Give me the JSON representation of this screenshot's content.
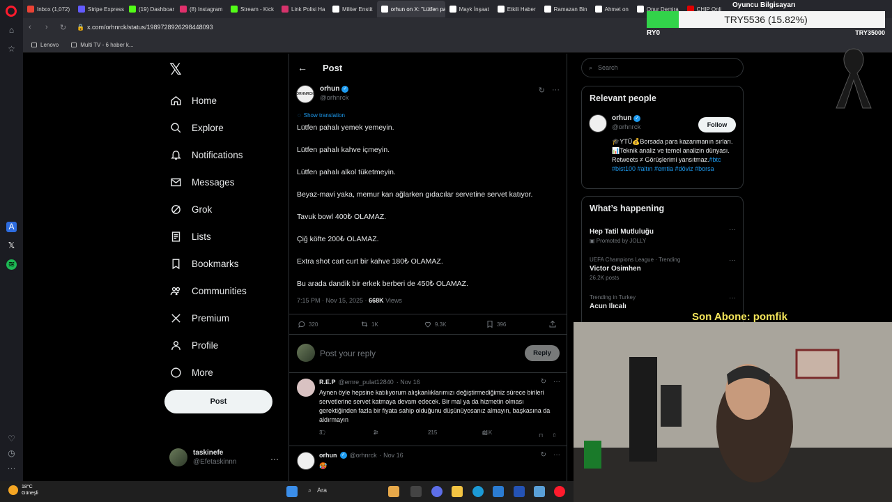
{
  "browser": {
    "tabs": [
      {
        "label": "Inbox (1,072)",
        "color": "#ea4335"
      },
      {
        "label": "Stripe Express",
        "color": "#635bff"
      },
      {
        "label": "(19) Dashboar",
        "color": "#53fc18"
      },
      {
        "label": "(8) Instagram",
        "color": "#e1306c"
      },
      {
        "label": "Stream - Kick",
        "color": "#53fc18"
      },
      {
        "label": "Link Polisi Ha",
        "color": "#d6336c"
      },
      {
        "label": "Militer Enstit",
        "color": "#ffffff"
      },
      {
        "label": "orhun on X: \"Lütfen pah",
        "color": "#ffffff",
        "active": true
      },
      {
        "label": "Mayk İnşaat",
        "color": "#ffffff"
      },
      {
        "label": "Etkili Haber",
        "color": "#ffffff"
      },
      {
        "label": "Ramazan Bin",
        "color": "#ffffff"
      },
      {
        "label": "Ahmet on",
        "color": "#ffffff"
      },
      {
        "label": "Onur Demira",
        "color": "#ffffff"
      },
      {
        "label": "CHIP Onli",
        "color": "#e00000"
      }
    ],
    "url": "x.com/orhnrck/status/1989728926298448093",
    "bookmarks": [
      "Lenovo",
      "Multi TV - 6 haber k..."
    ]
  },
  "nav": {
    "items": [
      {
        "label": "Home",
        "icon": "home-icon"
      },
      {
        "label": "Explore",
        "icon": "search-icon"
      },
      {
        "label": "Notifications",
        "icon": "bell-icon"
      },
      {
        "label": "Messages",
        "icon": "mail-icon"
      },
      {
        "label": "Grok",
        "icon": "grok-icon"
      },
      {
        "label": "Lists",
        "icon": "list-icon"
      },
      {
        "label": "Bookmarks",
        "icon": "bookmark-icon"
      },
      {
        "label": "Communities",
        "icon": "people-icon"
      },
      {
        "label": "Premium",
        "icon": "x-icon"
      },
      {
        "label": "Profile",
        "icon": "person-icon"
      },
      {
        "label": "More",
        "icon": "more-circle-icon"
      }
    ],
    "post_button": "Post",
    "account": {
      "name": "taskinefe",
      "handle": "@Efetaskinnn",
      "more": "···"
    }
  },
  "post": {
    "header": "Post",
    "author": {
      "name": "orhun",
      "handle": "@orhnrck",
      "avatar_text": "ORHNRCK"
    },
    "show_translation": "Show translation",
    "lines": [
      "Lütfen pahalı yemek yemeyin.",
      "Lütfen pahalı kahve içmeyin.",
      "Lütfen pahalı alkol tüketmeyin.",
      "Beyaz-mavi yaka, memur kan ağlarken gıdacılar servetine servet katıyor.",
      "Tavuk bowl 400₺ OLAMAZ.",
      "Çiğ köfte 200₺ OLAMAZ.",
      "Extra shot cart curt bir kahve 180₺ OLAMAZ.",
      "Bu arada dandik bir erkek berberi de 450₺ OLAMAZ."
    ],
    "time": "7:15 PM · Nov 15, 2025 · ",
    "views_count": "668K",
    "views_label": " Views",
    "stats": {
      "replies": "320",
      "reposts": "1K",
      "likes": "9.3K",
      "bookmarks": "396"
    },
    "reply_placeholder": "Post your reply",
    "reply_button": "Reply"
  },
  "replies": [
    {
      "name": "R.E.P",
      "handle": "@emre_pulat12840",
      "date": "· Nov 16",
      "text": "Aynen öyle hepsine katılıyorum alışkanlıklarımızı değiştirmediğimiz sürece birileri servetlerine servet katmaya devam edecek. Bir mal ya da hizmetin olması gerektiğinden fazla bir fiyata sahip olduğunu düşünüyosanız almayın, başkasına da aldırmayın",
      "replies": "3",
      "reposts": "2",
      "likes": "215",
      "views": "41K"
    },
    {
      "name": "orhun",
      "handle": "@orhnrck",
      "date": "· Nov 16",
      "text": "🥵"
    }
  ],
  "sidebar": {
    "search_placeholder": "Search",
    "relevant_title": "Relevant people",
    "person": {
      "name": "orhun",
      "handle": "@orhnrck",
      "follow": "Follow",
      "bio": "🎓YTÜ💰Borsada para kazanmanın sırları. 📊Teknik analiz ve temel analizin dünyası. Retweets ≠ Görüşlerimi yansıtmaz.",
      "tags": "#btc #bist100 #altın #emtia #döviz #borsa"
    },
    "happening_title": "What’s happening",
    "trends": [
      {
        "context": "",
        "title": "Hep Tatil Mutluluğu",
        "sub": "Promoted by JOLLY"
      },
      {
        "context": "UEFA Champions League · Trending",
        "title": "Victor Osimhen",
        "sub": "26.2K posts"
      },
      {
        "context": "Trending in Turkey",
        "title": "Acun Ilıcalı",
        "sub": ""
      }
    ]
  },
  "stream": {
    "oyuncu": "Oyuncu Bilgisayarı",
    "counter_value": "TRY5536 (15.82%)",
    "counter_progress": 0.1582,
    "counter_low": "RY0",
    "counter_high": "TRY35000",
    "subscriber_alert": "Son Abone: pomfik"
  },
  "taskbar": {
    "temp": "18°C",
    "weather": "Güneşli",
    "search": "Ara"
  }
}
